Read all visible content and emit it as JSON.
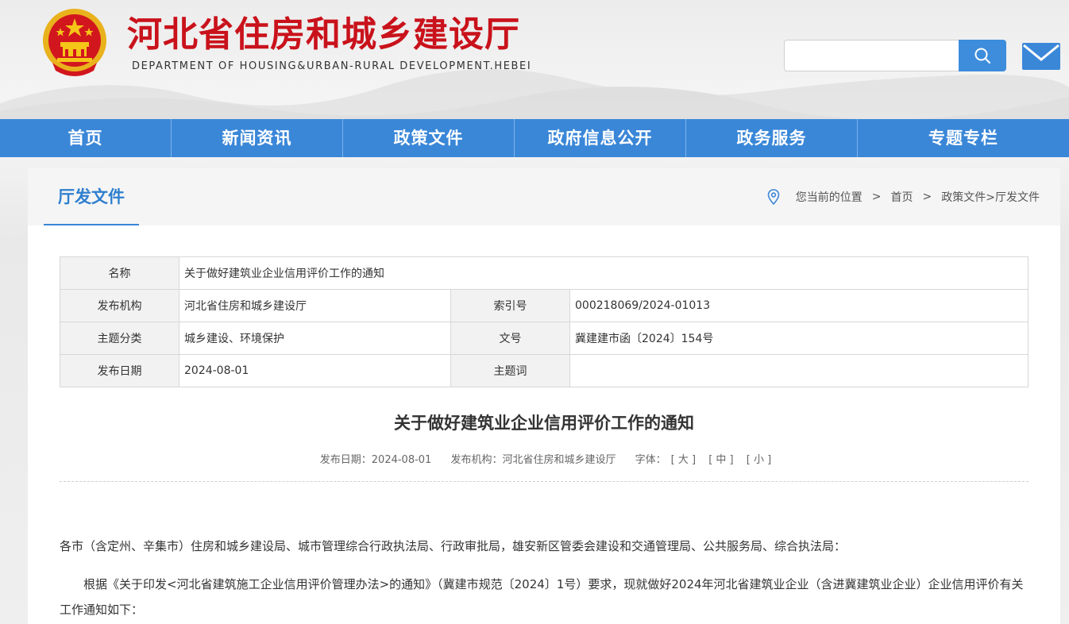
{
  "header": {
    "title": "河北省住房和城乡建设厅",
    "subtitle": "DEPARTMENT OF HOUSING&URBAN-RURAL DEVELOPMENT.HEBEI",
    "search": {
      "value": "",
      "placeholder": ""
    }
  },
  "nav": {
    "items": [
      "首页",
      "新闻资讯",
      "政策文件",
      "政府信息公开",
      "政务服务",
      "专题专栏"
    ]
  },
  "section": {
    "title": "厅发文件",
    "breadcrumb": {
      "prefix": "您当前的位置",
      "home": "首页",
      "path": "政策文件>厅发文件"
    }
  },
  "meta": {
    "name_label": "名称",
    "name_value": "关于做好建筑业企业信用评价工作的通知",
    "org_label": "发布机构",
    "org_value": "河北省住房和城乡建设厅",
    "index_label": "索引号",
    "index_value": "000218069/2024-01013",
    "topic_label": "主题分类",
    "topic_value": "城乡建设、环境保护",
    "docno_label": "文号",
    "docno_value": "冀建建市函〔2024〕154号",
    "date_label": "发布日期",
    "date_value": "2024-08-01",
    "keyword_label": "主题词",
    "keyword_value": ""
  },
  "article": {
    "title": "关于做好建筑业企业信用评价工作的通知",
    "date_text": "发布日期：2024-08-01",
    "org_text": "发布机构：河北省住房和城乡建设厅",
    "font_label": "字体：",
    "font_large": "[ 大 ]",
    "font_medium": "[ 中 ]",
    "font_small": "[ 小 ]",
    "para1": "各市（含定州、辛集市）住房和城乡建设局、城市管理综合行政执法局、行政审批局，雄安新区管委会建设和交通管理局、公共服务局、综合执法局：",
    "para2": "根据《关于印发<河北省建筑施工企业信用评价管理办法>的通知》（冀建市规范〔2024〕1号）要求，现就做好2024年河北省建筑业企业（含进冀建筑业企业）企业信用评价有关工作通知如下："
  },
  "colors": {
    "brand_red": "#c9121b",
    "nav_blue": "#3a87d8",
    "accent_blue": "#2f7fcf"
  },
  "icons": {
    "emblem": "national-emblem",
    "search": "search-icon",
    "mail": "mail-icon",
    "location": "location-pin-icon"
  }
}
